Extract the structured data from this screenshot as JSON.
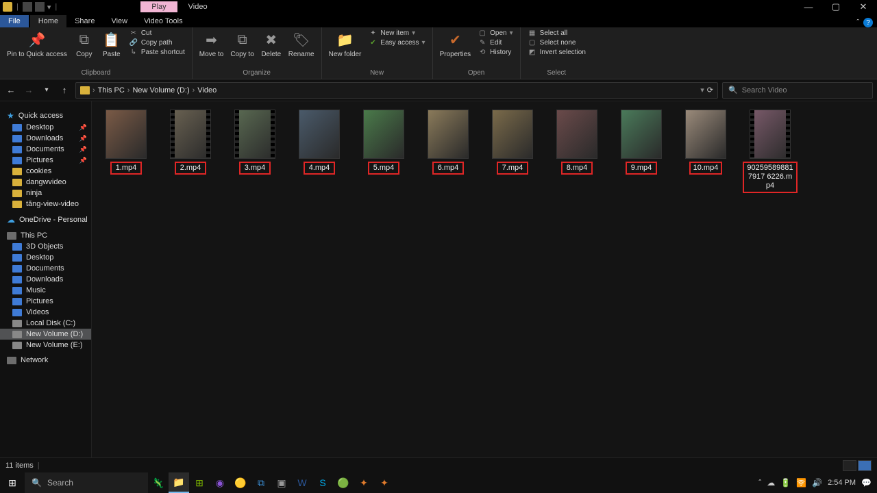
{
  "title": {
    "play_tab": "Play",
    "title_text": "Video"
  },
  "menu": {
    "file": "File",
    "home": "Home",
    "share": "Share",
    "view": "View",
    "video_tools": "Video Tools"
  },
  "ribbon": {
    "clipboard": {
      "label": "Clipboard",
      "pin": "Pin to Quick access",
      "copy": "Copy",
      "paste": "Paste",
      "cut": "Cut",
      "copy_path": "Copy path",
      "paste_shortcut": "Paste shortcut"
    },
    "organize": {
      "label": "Organize",
      "move_to": "Move to",
      "copy_to": "Copy to",
      "delete": "Delete",
      "rename": "Rename"
    },
    "new": {
      "label": "New",
      "new_folder": "New folder",
      "new_item": "New item",
      "easy_access": "Easy access"
    },
    "open": {
      "label": "Open",
      "properties": "Properties",
      "open": "Open",
      "edit": "Edit",
      "history": "History"
    },
    "select": {
      "label": "Select",
      "select_all": "Select all",
      "select_none": "Select none",
      "invert_selection": "Invert selection"
    }
  },
  "breadcrumb": {
    "this_pc": "This PC",
    "drive": "New Volume (D:)",
    "folder": "Video"
  },
  "search": {
    "placeholder": "Search Video"
  },
  "sidebar": {
    "quick_access": "Quick access",
    "desktop": "Desktop",
    "downloads": "Downloads",
    "documents": "Documents",
    "pictures": "Pictures",
    "cookies": "cookies",
    "dangwvideo": "dangwvideo",
    "ninja": "ninja",
    "tang_view": "tăng-view-video",
    "onedrive": "OneDrive - Personal",
    "this_pc": "This PC",
    "objects3d": "3D Objects",
    "desktop2": "Desktop",
    "documents2": "Documents",
    "downloads2": "Downloads",
    "music": "Music",
    "pictures2": "Pictures",
    "videos": "Videos",
    "local_c": "Local Disk (C:)",
    "vol_d": "New Volume (D:)",
    "vol_e": "New Volume (E:)",
    "network": "Network"
  },
  "files": [
    {
      "name": "1.mp4"
    },
    {
      "name": "2.mp4"
    },
    {
      "name": "3.mp4"
    },
    {
      "name": "4.mp4"
    },
    {
      "name": "5.mp4"
    },
    {
      "name": "6.mp4"
    },
    {
      "name": "7.mp4"
    },
    {
      "name": "8.mp4"
    },
    {
      "name": "9.mp4"
    },
    {
      "name": "10.mp4"
    },
    {
      "name": "902595898817917 6226.mp4"
    }
  ],
  "status": {
    "count": "11 items"
  },
  "taskbar": {
    "search_placeholder": "Search",
    "time": "2:54 PM"
  }
}
